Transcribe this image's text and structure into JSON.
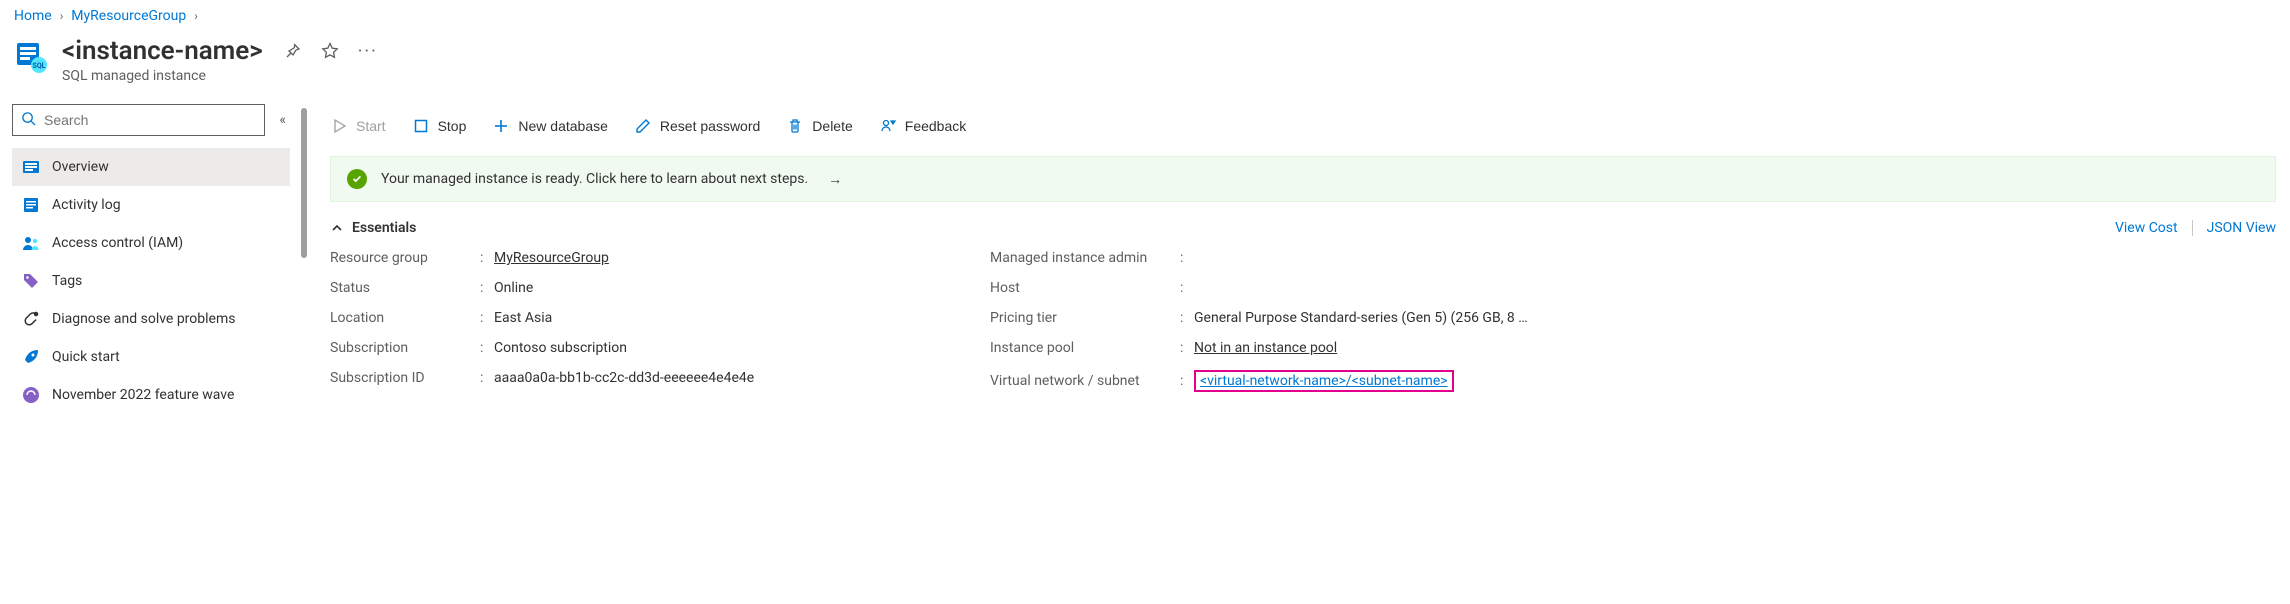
{
  "breadcrumb": {
    "home": "Home",
    "group": "MyResourceGroup"
  },
  "header": {
    "title": "<instance-name>",
    "subtitle": "SQL managed instance"
  },
  "search": {
    "placeholder": "Search"
  },
  "sidebar": {
    "items": [
      {
        "label": "Overview"
      },
      {
        "label": "Activity log"
      },
      {
        "label": "Access control (IAM)"
      },
      {
        "label": "Tags"
      },
      {
        "label": "Diagnose and solve problems"
      },
      {
        "label": "Quick start"
      },
      {
        "label": "November 2022 feature wave"
      }
    ]
  },
  "toolbar": {
    "start": "Start",
    "stop": "Stop",
    "new_db": "New database",
    "reset_pw": "Reset password",
    "delete": "Delete",
    "feedback": "Feedback"
  },
  "banner": {
    "text": "Your managed instance is ready. Click here to learn about next steps."
  },
  "essentials": {
    "title": "Essentials",
    "view_cost": "View Cost",
    "json_view": "JSON View",
    "left": {
      "rg_label": "Resource group",
      "rg_value": "MyResourceGroup",
      "status_label": "Status",
      "status_value": "Online",
      "location_label": "Location",
      "location_value": "East Asia",
      "sub_label": "Subscription",
      "sub_value": "Contoso subscription",
      "subid_label": "Subscription ID",
      "subid_value": "aaaa0a0a-bb1b-cc2c-dd3d-eeeeee4e4e4e"
    },
    "right": {
      "admin_label": "Managed instance admin",
      "admin_value": "",
      "host_label": "Host",
      "host_value": "",
      "tier_label": "Pricing tier",
      "tier_value": "General Purpose Standard-series (Gen 5) (256 GB, 8 …",
      "pool_label": "Instance pool",
      "pool_value": "Not in an instance pool",
      "vnet_label": "Virtual network / subnet",
      "vnet_value": "<virtual-network-name>/<subnet-name>"
    }
  }
}
